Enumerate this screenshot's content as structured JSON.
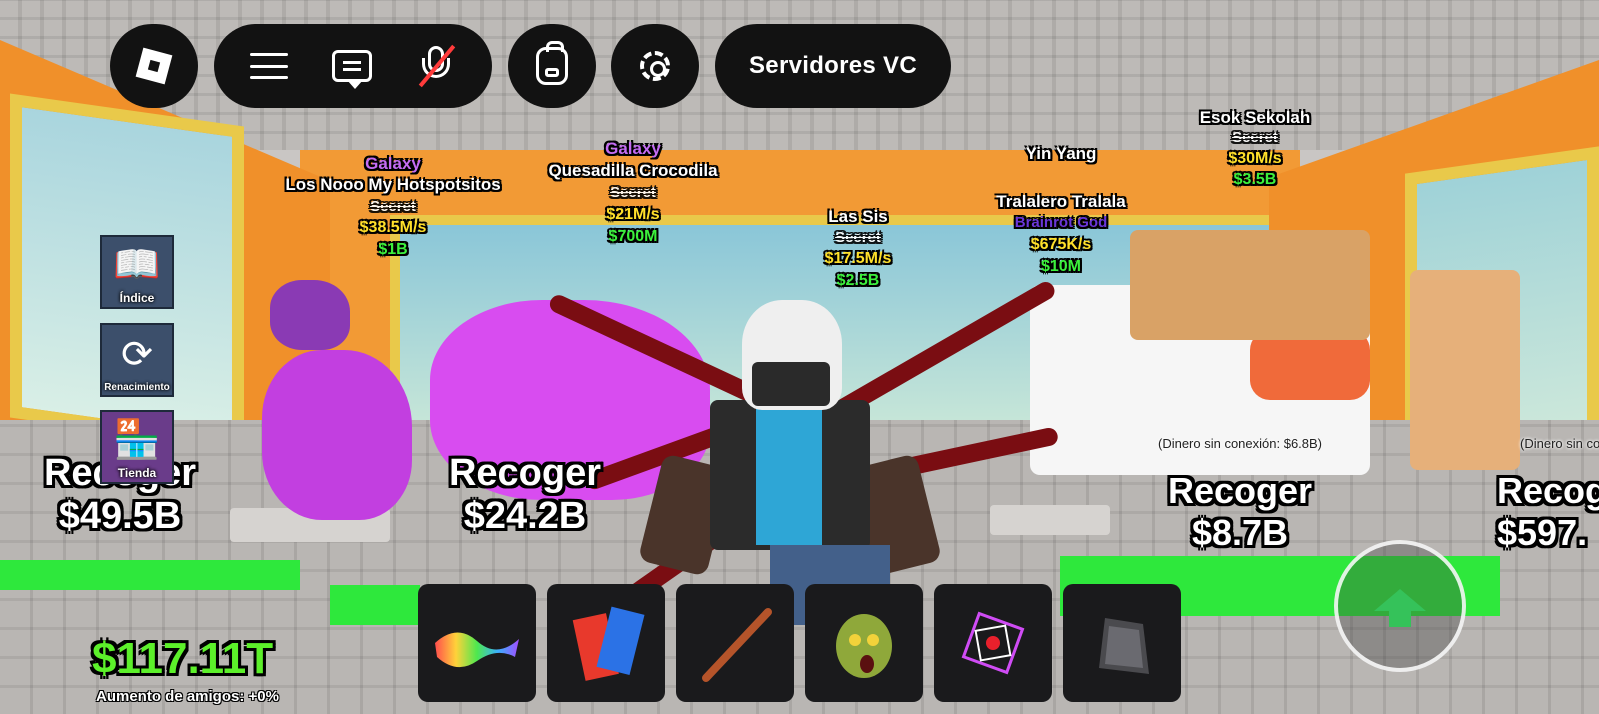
{
  "topbar": {
    "vc_button_label": "Servidores VC"
  },
  "side_buttons": [
    {
      "label": "Índice"
    },
    {
      "label": "Renacimiento"
    },
    {
      "label": "Tienda"
    }
  ],
  "brainrots": [
    {
      "mutation": "Galaxy",
      "name": "Los Nooo My Hotspotsitos",
      "rarity": "Secret",
      "rate": "$38.5M/s",
      "price": "$1B"
    },
    {
      "mutation": "Galaxy",
      "name": "Quesadilla Crocodila",
      "rarity": "Secret",
      "rate": "$21M/s",
      "price": "$700M"
    },
    {
      "mutation": "",
      "name": "Las Sis",
      "rarity": "Secret",
      "rate": "$17.5M/s",
      "price": "$2.5B"
    },
    {
      "mutation": "Yin Yang",
      "name": "Tralalero Tralala",
      "rarity": "Brainrot God",
      "rate": "$675K/s",
      "price": "$10M"
    },
    {
      "mutation": "",
      "name": "Esok Sekolah",
      "rarity": "Secret",
      "rate": "$30M/s",
      "price": "$3.5B"
    }
  ],
  "collect_pads": [
    {
      "label": "Recoger",
      "amount": "$49.5B"
    },
    {
      "label": "Recoger",
      "amount": "$24.2B"
    },
    {
      "label": "Recoger",
      "amount": "$8.7B",
      "offline": "(Dinero sin conexión: $6.8B)"
    },
    {
      "label": "Recog",
      "amount": "$597.",
      "offline": "(Dinero sin conexi"
    }
  ],
  "hotbar": [
    {
      "icon": "flying-carpet-icon"
    },
    {
      "icon": "blue-red-figure-icon"
    },
    {
      "icon": "baseball-bat-icon"
    },
    {
      "icon": "zombie-head-icon"
    },
    {
      "icon": "purple-cube-icon"
    },
    {
      "icon": "dark-cloak-icon"
    }
  ],
  "hud": {
    "money": "$117.11T",
    "friend_boost": "Aumento de amigos: +0%"
  },
  "colors": {
    "galaxy": "#c46cf2",
    "rate": "#ffe02a",
    "price": "#3cf03c",
    "money": "#5cf02a",
    "topbar_bg": "#121212",
    "side_button_bg": "#3c4f6b"
  }
}
